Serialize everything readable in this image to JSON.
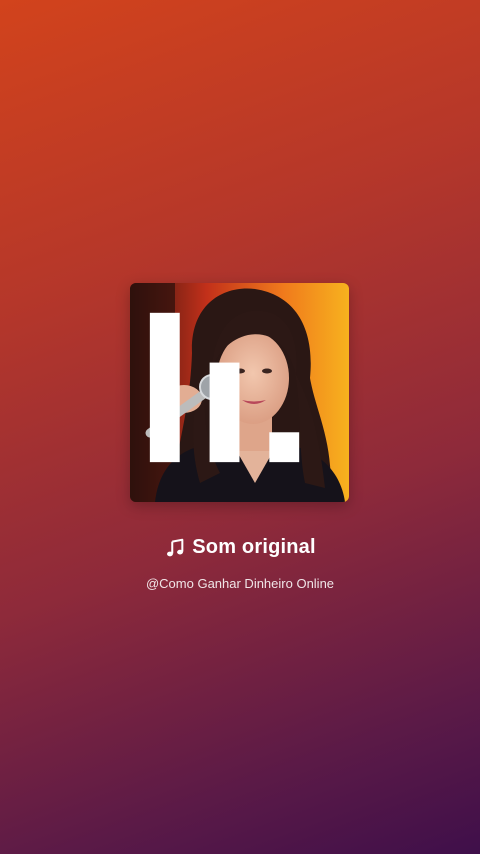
{
  "audio": {
    "title": "Som original",
    "author": "@Como Ganhar Dinheiro Online",
    "note_icon": "music-note-icon",
    "cover_badge_icon": "reels-bars-icon"
  },
  "colors": {
    "gradient_top": "#d2431c",
    "gradient_bottom": "#3f0f4a",
    "text": "#ffffff"
  }
}
